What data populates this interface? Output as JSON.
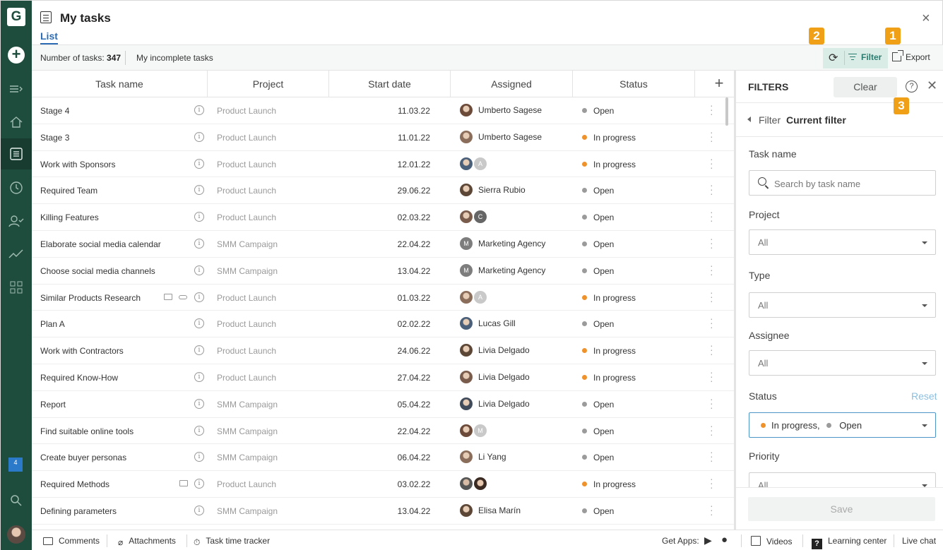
{
  "rail": {
    "badge_count": "4"
  },
  "header": {
    "title": "My tasks",
    "tab_list": "List",
    "close": "×"
  },
  "toolbar": {
    "count_label": "Number of tasks:",
    "count_value": "347",
    "incomplete": "My incomplete tasks",
    "filter": "Filter",
    "export": "Export"
  },
  "callouts": {
    "one": "1",
    "two": "2",
    "three": "3"
  },
  "table": {
    "columns": [
      "Task name",
      "Project",
      "Start date",
      "Assigned",
      "Status"
    ],
    "rows": [
      {
        "name": "Stage 4",
        "project": "Product Launch",
        "date": "11.03.22",
        "assignee": "Umberto Sagese",
        "status": "Open"
      },
      {
        "name": "Stage 3",
        "project": "Product Launch",
        "date": "11.01.22",
        "assignee": "Umberto Sagese",
        "status": "In progress"
      },
      {
        "name": "Work with Sponsors",
        "project": "Product Launch",
        "date": "12.01.22",
        "assignee": "",
        "letter": "A",
        "status": "In progress"
      },
      {
        "name": "Required Team",
        "project": "Product Launch",
        "date": "29.06.22",
        "assignee": "Sierra Rubio",
        "status": "Open"
      },
      {
        "name": "Killing Features",
        "project": "Product Launch",
        "date": "02.03.22",
        "assignee": "",
        "letter": "C",
        "status": "Open"
      },
      {
        "name": "Elaborate social media calendar",
        "project": "SMM Campaign",
        "date": "22.04.22",
        "assignee": "Marketing Agency",
        "letter": "M",
        "status": "Open"
      },
      {
        "name": "Choose social media channels",
        "project": "SMM Campaign",
        "date": "13.04.22",
        "assignee": "Marketing Agency",
        "letter": "M",
        "status": "Open"
      },
      {
        "name": "Similar Products Research",
        "project": "Product Launch",
        "date": "01.03.22",
        "assignee": "",
        "letter": "A",
        "status": "In progress"
      },
      {
        "name": "Plan A",
        "project": "Product Launch",
        "date": "02.02.22",
        "assignee": "Lucas Gill",
        "status": "Open"
      },
      {
        "name": "Work with Contractors",
        "project": "Product Launch",
        "date": "24.06.22",
        "assignee": "Livia Delgado",
        "status": "In progress"
      },
      {
        "name": "Required Know-How",
        "project": "Product Launch",
        "date": "27.04.22",
        "assignee": "Livia Delgado",
        "status": "In progress"
      },
      {
        "name": "Report",
        "project": "SMM Campaign",
        "date": "05.04.22",
        "assignee": "Livia Delgado",
        "status": "Open"
      },
      {
        "name": "Find suitable online tools",
        "project": "SMM Campaign",
        "date": "22.04.22",
        "assignee": "",
        "letter": "M",
        "status": "Open"
      },
      {
        "name": "Create buyer personas",
        "project": "SMM Campaign",
        "date": "06.04.22",
        "assignee": "Li Yang",
        "status": "Open"
      },
      {
        "name": "Required Methods",
        "project": "Product Launch",
        "date": "03.02.22",
        "assignee": "",
        "status": "In progress"
      },
      {
        "name": "Defining parameters",
        "project": "SMM Campaign",
        "date": "13.04.22",
        "assignee": "Elisa Marín",
        "status": "Open"
      }
    ]
  },
  "filters": {
    "title": "FILTERS",
    "clear": "Clear",
    "crumb_filter": "Filter",
    "crumb_current": "Current filter",
    "task_name_label": "Task name",
    "task_name_placeholder": "Search by task name",
    "project_label": "Project",
    "project_value": "All",
    "type_label": "Type",
    "type_value": "All",
    "assignee_label": "Assignee",
    "assignee_value": "All",
    "status_label": "Status",
    "status_reset": "Reset",
    "status_value_1": "In progress,",
    "status_value_2": "Open",
    "priority_label": "Priority",
    "priority_value": "All",
    "save": "Save"
  },
  "footer": {
    "comments": "Comments",
    "attachments": "Attachments",
    "time_tracker": "Task time tracker",
    "get_apps": "Get Apps:",
    "videos": "Videos",
    "learning_center": "Learning center",
    "live_chat": "Live chat"
  },
  "colors": {
    "in_progress": "#f0922b",
    "open": "#9b9b9b",
    "rail": "#1f4d3d",
    "accent": "#2a7c6f",
    "callout": "#f0a016"
  }
}
